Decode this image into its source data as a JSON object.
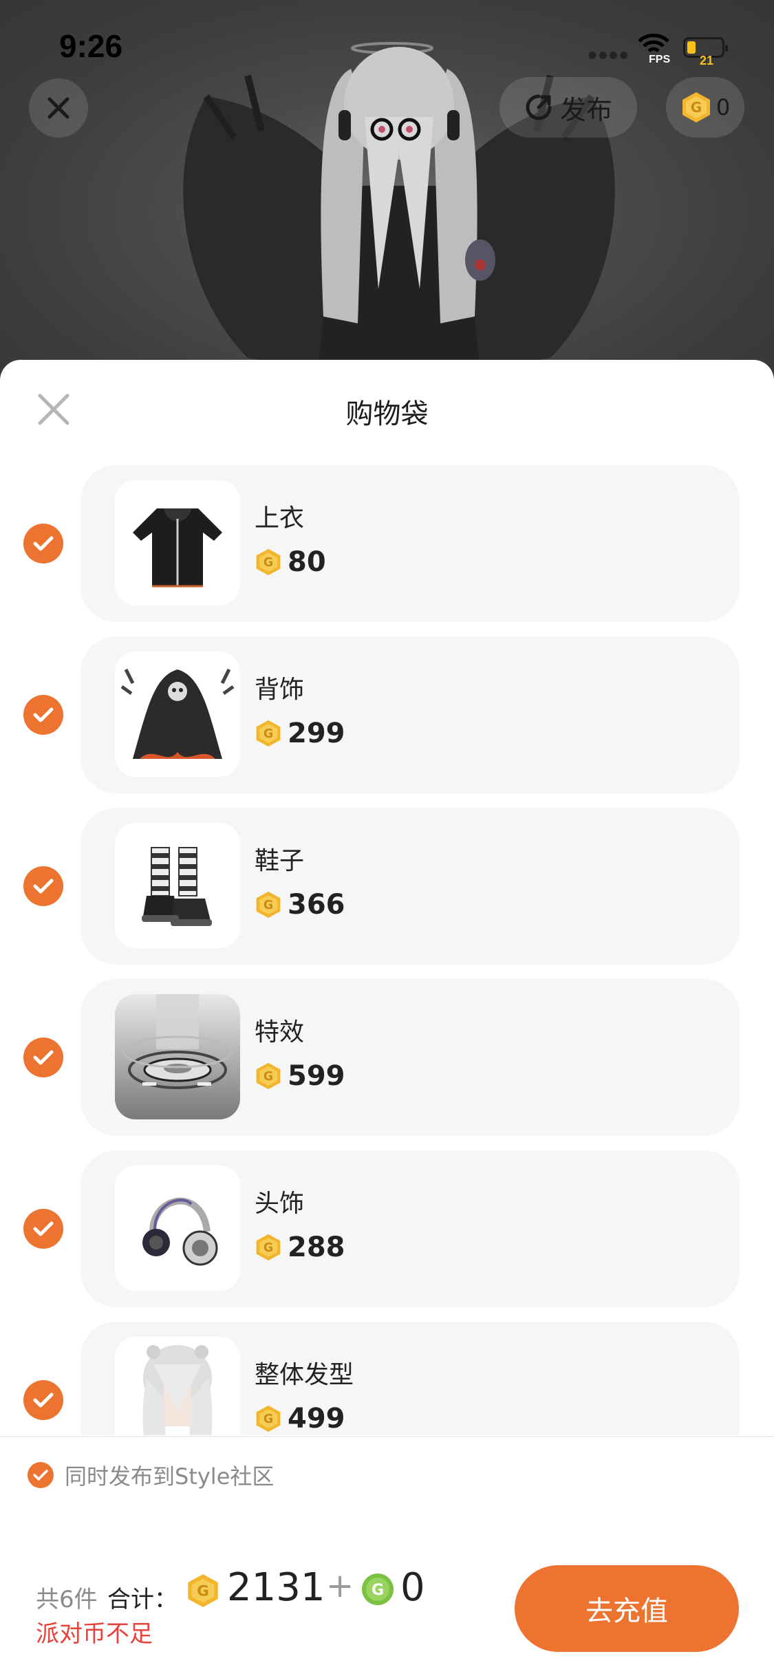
{
  "status_bar": {
    "time": "9:26",
    "fps_label": "FPS",
    "battery_level": "21"
  },
  "top_bar": {
    "publish_label": "发布",
    "coin_balance": "0"
  },
  "sheet": {
    "title": "购物袋",
    "items": [
      {
        "name": "上衣",
        "price": "80",
        "icon": "hoodie-thumbnail",
        "checked": true
      },
      {
        "name": "背饰",
        "price": "299",
        "icon": "reaper-cloak-thumbnail",
        "checked": true
      },
      {
        "name": "鞋子",
        "price": "366",
        "icon": "platform-boots-thumbnail",
        "checked": true
      },
      {
        "name": "特效",
        "price": "599",
        "icon": "ring-effect-thumbnail",
        "checked": true
      },
      {
        "name": "头饰",
        "price": "288",
        "icon": "headphones-thumbnail",
        "checked": true
      },
      {
        "name": "整体发型",
        "price": "499",
        "icon": "white-hair-thumbnail",
        "checked": true
      }
    ],
    "sync_label": "同时发布到Style社区",
    "sync_checked": true
  },
  "footer": {
    "count_label": "共6件",
    "total_label": "合计：",
    "total_coins": "2131",
    "plus": "+",
    "green_coins": "0",
    "warning": "派对币不足",
    "recharge_label": "去充值"
  },
  "colors": {
    "accent": "#ed7430",
    "warning": "#e8413a",
    "coin": "#f2b52c",
    "green_coin": "#7cc242"
  }
}
